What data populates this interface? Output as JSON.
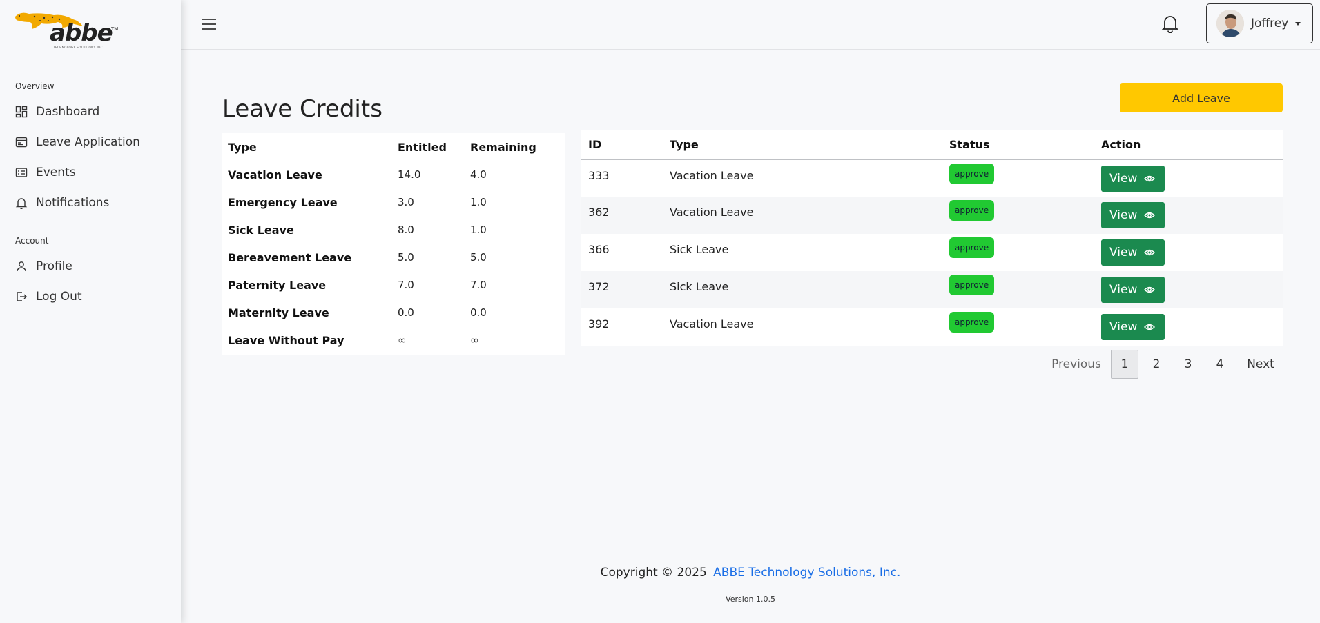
{
  "brand": {
    "logo_text": "abbe",
    "logo_tagline": "TECHNOLOGY SOLUTIONS INC.",
    "logo_tm": "TM",
    "accent": "#ffc800"
  },
  "sidebar": {
    "overview_title": "Overview",
    "account_title": "Account",
    "items": [
      {
        "label": "Dashboard",
        "icon": "dashboard-icon"
      },
      {
        "label": "Leave Application",
        "icon": "leave-application-icon"
      },
      {
        "label": "Events",
        "icon": "events-icon"
      },
      {
        "label": "Notifications",
        "icon": "bell-icon"
      },
      {
        "label": "Profile",
        "icon": "user-icon"
      },
      {
        "label": "Log Out",
        "icon": "logout-icon"
      }
    ]
  },
  "topbar": {
    "user_name": "Joffrey"
  },
  "main": {
    "title": "Leave Credits",
    "add_button": "Add Leave"
  },
  "credits": {
    "headers": [
      "Type",
      "Entitled",
      "Remaining"
    ],
    "rows": [
      {
        "type": "Vacation Leave",
        "entitled": "14.0",
        "remaining": "4.0"
      },
      {
        "type": "Emergency Leave",
        "entitled": "3.0",
        "remaining": "1.0"
      },
      {
        "type": "Sick Leave",
        "entitled": "8.0",
        "remaining": "1.0"
      },
      {
        "type": "Bereavement Leave",
        "entitled": "5.0",
        "remaining": "5.0"
      },
      {
        "type": "Paternity Leave",
        "entitled": "7.0",
        "remaining": "7.0"
      },
      {
        "type": "Maternity Leave",
        "entitled": "0.0",
        "remaining": "0.0"
      },
      {
        "type": "Leave Without Pay",
        "entitled": "∞",
        "remaining": "∞"
      }
    ]
  },
  "leaves": {
    "headers": [
      "ID",
      "Type",
      "Status",
      "Action"
    ],
    "rows": [
      {
        "id": "333",
        "type": "Vacation Leave",
        "status": "approve",
        "action": "View"
      },
      {
        "id": "362",
        "type": "Vacation Leave",
        "status": "approve",
        "action": "View"
      },
      {
        "id": "366",
        "type": "Sick Leave",
        "status": "approve",
        "action": "View"
      },
      {
        "id": "372",
        "type": "Sick Leave",
        "status": "approve",
        "action": "View"
      },
      {
        "id": "392",
        "type": "Vacation Leave",
        "status": "approve",
        "action": "View"
      }
    ],
    "status_color": "#21c932",
    "view_color": "#1b8a4f"
  },
  "pagination": {
    "previous": "Previous",
    "pages": [
      "1",
      "2",
      "3",
      "4"
    ],
    "next": "Next",
    "current": "1"
  },
  "footer": {
    "copyright": "Copyright © 2025",
    "company": "ABBE Technology Solutions, Inc.",
    "version": "Version 1.0.5"
  }
}
